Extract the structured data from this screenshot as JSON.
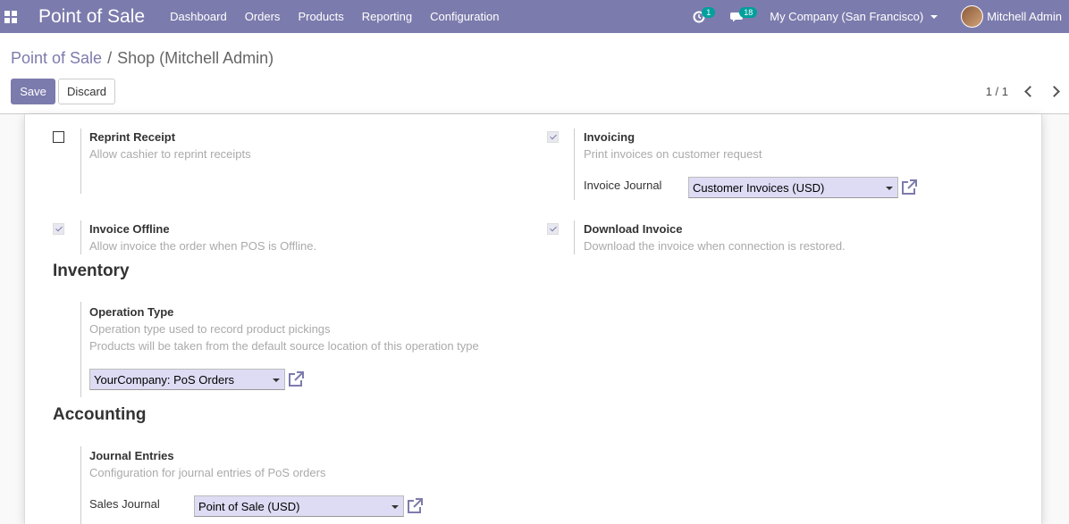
{
  "navbar": {
    "app_title": "Point of Sale",
    "menu": [
      "Dashboard",
      "Orders",
      "Products",
      "Reporting",
      "Configuration"
    ],
    "activity_count": "1",
    "messages_count": "18",
    "company": "My Company (San Francisco)",
    "user": "Mitchell Admin"
  },
  "breadcrumb": {
    "parent": "Point of Sale",
    "separator": "/",
    "current": "Shop (Mitchell Admin)"
  },
  "buttons": {
    "save": "Save",
    "discard": "Discard"
  },
  "pager": {
    "value": "1 / 1"
  },
  "settings": {
    "reprint": {
      "title": "Reprint Receipt",
      "desc": "Allow cashier to reprint receipts",
      "checked": false
    },
    "invoicing": {
      "title": "Invoicing",
      "desc": "Print invoices on customer request",
      "checked": true,
      "journal_label": "Invoice Journal",
      "journal_value": "Customer Invoices (USD)"
    },
    "invoice_offline": {
      "title": "Invoice Offline",
      "desc": "Allow invoice the order when POS is Offline.",
      "checked": true
    },
    "download_invoice": {
      "title": "Download Invoice",
      "desc": "Download the invoice when connection is restored.",
      "checked": true
    }
  },
  "inventory": {
    "section": "Inventory",
    "title": "Operation Type",
    "desc1": "Operation type used to record product pickings",
    "desc2": "Products will be taken from the default source location of this operation type",
    "value": "YourCompany: PoS Orders"
  },
  "accounting": {
    "section": "Accounting",
    "title": "Journal Entries",
    "desc": "Configuration for journal entries of PoS orders",
    "sales_label": "Sales Journal",
    "sales_value": "Point of Sale (USD)"
  },
  "icons": {
    "apps": "apps-grid-icon",
    "activity": "clock-icon",
    "messages": "chat-icon",
    "external": "external-link-icon"
  },
  "colors": {
    "brand": "#7c7bad",
    "badge": "#00a09d",
    "select_bg": "#dedcf4"
  }
}
